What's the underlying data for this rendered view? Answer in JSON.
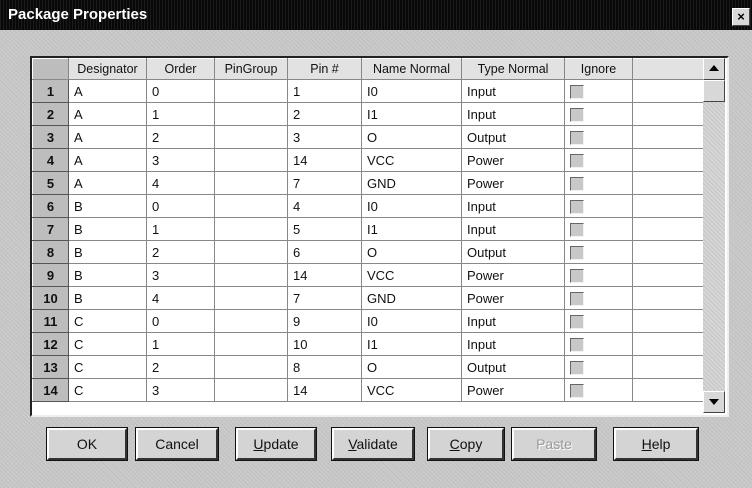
{
  "window": {
    "title": "Package Properties",
    "close_label": "×"
  },
  "grid": {
    "columns": [
      "Designator",
      "Order",
      "PinGroup",
      "Pin #",
      "Name Normal",
      "Type Normal",
      "Ignore"
    ],
    "rows": [
      {
        "num": "1",
        "designator": "A",
        "order": "0",
        "pingroup": "",
        "pin": "1",
        "name": "I0",
        "type": "Input",
        "ignore": false
      },
      {
        "num": "2",
        "designator": "A",
        "order": "1",
        "pingroup": "",
        "pin": "2",
        "name": "I1",
        "type": "Input",
        "ignore": false
      },
      {
        "num": "3",
        "designator": "A",
        "order": "2",
        "pingroup": "",
        "pin": "3",
        "name": "O",
        "type": "Output",
        "ignore": false
      },
      {
        "num": "4",
        "designator": "A",
        "order": "3",
        "pingroup": "",
        "pin": "14",
        "name": "VCC",
        "type": "Power",
        "ignore": false
      },
      {
        "num": "5",
        "designator": "A",
        "order": "4",
        "pingroup": "",
        "pin": "7",
        "name": "GND",
        "type": "Power",
        "ignore": false
      },
      {
        "num": "6",
        "designator": "B",
        "order": "0",
        "pingroup": "",
        "pin": "4",
        "name": "I0",
        "type": "Input",
        "ignore": false
      },
      {
        "num": "7",
        "designator": "B",
        "order": "1",
        "pingroup": "",
        "pin": "5",
        "name": "I1",
        "type": "Input",
        "ignore": false
      },
      {
        "num": "8",
        "designator": "B",
        "order": "2",
        "pingroup": "",
        "pin": "6",
        "name": "O",
        "type": "Output",
        "ignore": false
      },
      {
        "num": "9",
        "designator": "B",
        "order": "3",
        "pingroup": "",
        "pin": "14",
        "name": "VCC",
        "type": "Power",
        "ignore": false
      },
      {
        "num": "10",
        "designator": "B",
        "order": "4",
        "pingroup": "",
        "pin": "7",
        "name": "GND",
        "type": "Power",
        "ignore": false
      },
      {
        "num": "11",
        "designator": "C",
        "order": "0",
        "pingroup": "",
        "pin": "9",
        "name": "I0",
        "type": "Input",
        "ignore": false
      },
      {
        "num": "12",
        "designator": "C",
        "order": "1",
        "pingroup": "",
        "pin": "10",
        "name": "I1",
        "type": "Input",
        "ignore": false
      },
      {
        "num": "13",
        "designator": "C",
        "order": "2",
        "pingroup": "",
        "pin": "8",
        "name": "O",
        "type": "Output",
        "ignore": false
      },
      {
        "num": "14",
        "designator": "C",
        "order": "3",
        "pingroup": "",
        "pin": "14",
        "name": "VCC",
        "type": "Power",
        "ignore": false
      }
    ]
  },
  "buttons": [
    {
      "name": "ok-button",
      "label": "OK",
      "mnemonic": "",
      "disabled": false
    },
    {
      "name": "cancel-button",
      "label": "Cancel",
      "mnemonic": "",
      "disabled": false
    },
    {
      "name": "update-button",
      "label": "Update",
      "mnemonic": "U",
      "disabled": false
    },
    {
      "name": "validate-button",
      "label": "Validate",
      "mnemonic": "V",
      "disabled": false
    },
    {
      "name": "copy-button",
      "label": "Copy",
      "mnemonic": "C",
      "disabled": false
    },
    {
      "name": "paste-button",
      "label": "Paste",
      "mnemonic": "",
      "disabled": true
    },
    {
      "name": "help-button",
      "label": "Help",
      "mnemonic": "H",
      "disabled": false
    }
  ],
  "scrollbar": {
    "up_icon": "arrow-up-icon",
    "down_icon": "arrow-down-icon"
  }
}
